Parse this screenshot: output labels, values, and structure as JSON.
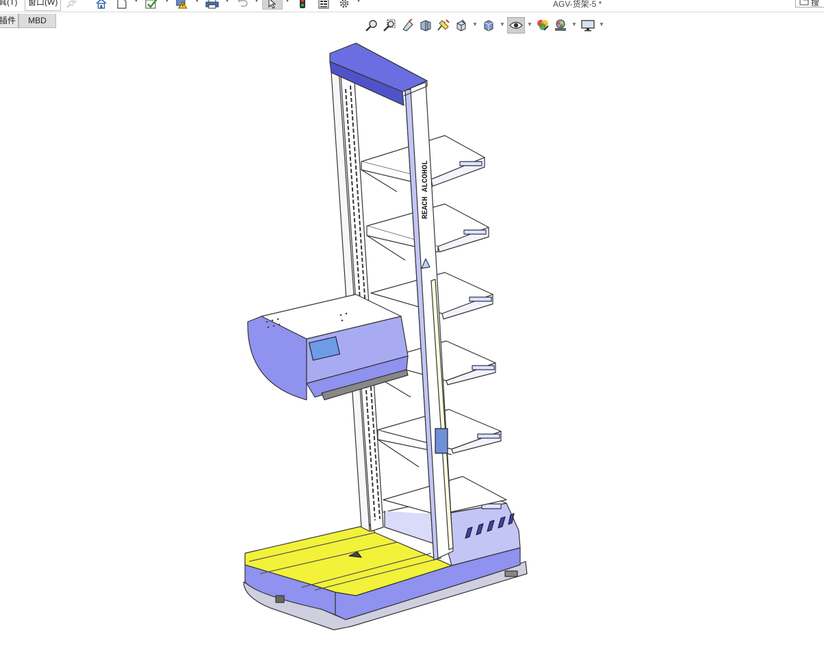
{
  "menu": {
    "tools_label": "具(T)",
    "window_label": "窗口(W)"
  },
  "title_bar": {
    "document_title": "AGV-货架-5 *",
    "search_label": "搜"
  },
  "tabs": {
    "plugins_label": "插件",
    "mbd_label": "MBD"
  },
  "model": {
    "mast_label": "REACH ALCOHOL",
    "part_colors": {
      "base_top": "#f2f23a",
      "body_blue": "#8f92ee",
      "body_blue_light": "#c3c5f7",
      "tray_edge": "#4f52c9",
      "background": "#ffffff"
    }
  },
  "icons": {
    "toolbar": [
      "home-icon",
      "new-document-icon",
      "checkmark-icon",
      "rebuild-warning-icon",
      "print-icon",
      "undo-icon",
      "select-cursor-icon",
      "traffic-light-icon",
      "file-properties-icon",
      "options-gear-icon"
    ],
    "heads_up": [
      "zoom-to-fit-icon",
      "zoom-to-area-icon",
      "previous-view-icon",
      "section-view-icon",
      "dynamic-annotation-icon",
      "view-orientation-icon",
      "display-style-icon",
      "hide-show-items-icon",
      "edit-appearance-icon",
      "apply-scene-icon",
      "view-settings-icon"
    ]
  }
}
